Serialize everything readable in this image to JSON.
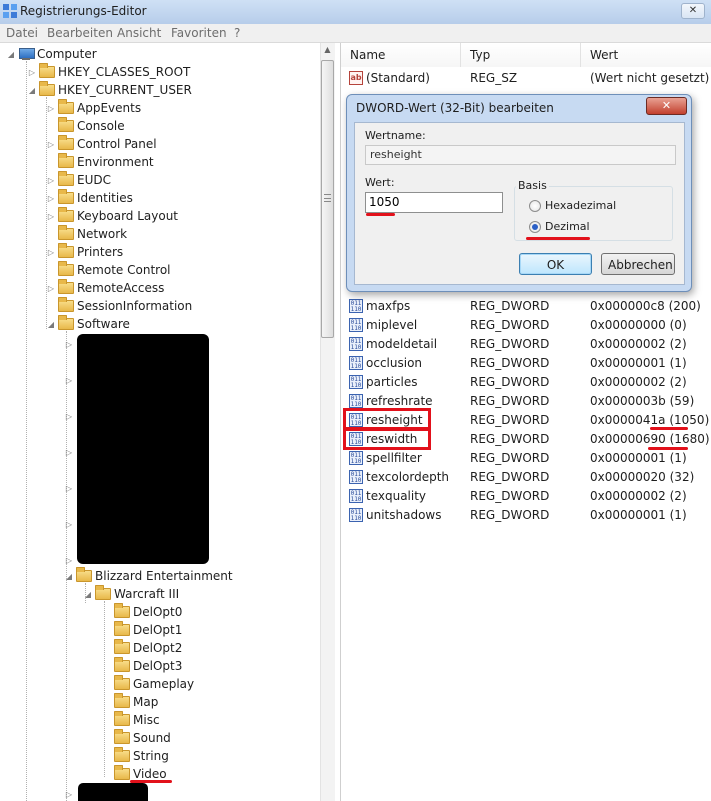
{
  "window": {
    "title": "Registrierungs-Editor",
    "close_glyph": "✕"
  },
  "menu": [
    "Datei",
    "Bearbeiten",
    "Ansicht",
    "Favoriten",
    "?"
  ],
  "tree": {
    "computer": "Computer",
    "hkcr": "HKEY_CLASSES_ROOT",
    "hkcu": "HKEY_CURRENT_USER",
    "hkcu_children": [
      "AppEvents",
      "Console",
      "Control Panel",
      "Environment",
      "EUDC",
      "Identities",
      "Keyboard Layout",
      "Network",
      "Printers",
      "Remote Control",
      "RemoteAccess",
      "SessionInformation",
      "Software"
    ],
    "blizzard": "Blizzard Entertainment",
    "warcraft": "Warcraft III",
    "warcraft_children": [
      "DelOpt0",
      "DelOpt1",
      "DelOpt2",
      "DelOpt3",
      "Gameplay",
      "Map",
      "Misc",
      "Sound",
      "String",
      "Video"
    ]
  },
  "list": {
    "headers": {
      "name": "Name",
      "type": "Typ",
      "value": "Wert"
    },
    "standard": {
      "name": "(Standard)",
      "type": "REG_SZ",
      "value": "(Wert nicht gesetzt)"
    },
    "rows": [
      {
        "name": "maxfps",
        "type": "REG_DWORD",
        "value": "0x000000c8 (200)"
      },
      {
        "name": "miplevel",
        "type": "REG_DWORD",
        "value": "0x00000000 (0)"
      },
      {
        "name": "modeldetail",
        "type": "REG_DWORD",
        "value": "0x00000002 (2)"
      },
      {
        "name": "occlusion",
        "type": "REG_DWORD",
        "value": "0x00000001 (1)"
      },
      {
        "name": "particles",
        "type": "REG_DWORD",
        "value": "0x00000002 (2)"
      },
      {
        "name": "refreshrate",
        "type": "REG_DWORD",
        "value": "0x0000003b (59)"
      },
      {
        "name": "resheight",
        "type": "REG_DWORD",
        "value": "0x0000041a (1050)"
      },
      {
        "name": "reswidth",
        "type": "REG_DWORD",
        "value": "0x00000690 (1680)"
      },
      {
        "name": "spellfilter",
        "type": "REG_DWORD",
        "value": "0x00000001 (1)"
      },
      {
        "name": "texcolordepth",
        "type": "REG_DWORD",
        "value": "0x00000020 (32)"
      },
      {
        "name": "texquality",
        "type": "REG_DWORD",
        "value": "0x00000002 (2)"
      },
      {
        "name": "unitshadows",
        "type": "REG_DWORD",
        "value": "0x00000001 (1)"
      }
    ]
  },
  "dialog": {
    "title": "DWORD-Wert (32-Bit) bearbeiten",
    "close_glyph": "✕",
    "name_label": "Wertname:",
    "name_value": "resheight",
    "value_label": "Wert:",
    "value_value": "1050",
    "basis_label": "Basis",
    "hex_label": "Hexadezimal",
    "dec_label": "Dezimal",
    "selected_basis": "Dezimal",
    "ok_label": "OK",
    "cancel_label": "Abbrechen"
  },
  "icons": {
    "dword": "011 110",
    "string": "ab"
  },
  "colors": {
    "highlight": "#e2111b",
    "dialog_frame": "#c7daf2",
    "close_button": "#c2402e"
  }
}
